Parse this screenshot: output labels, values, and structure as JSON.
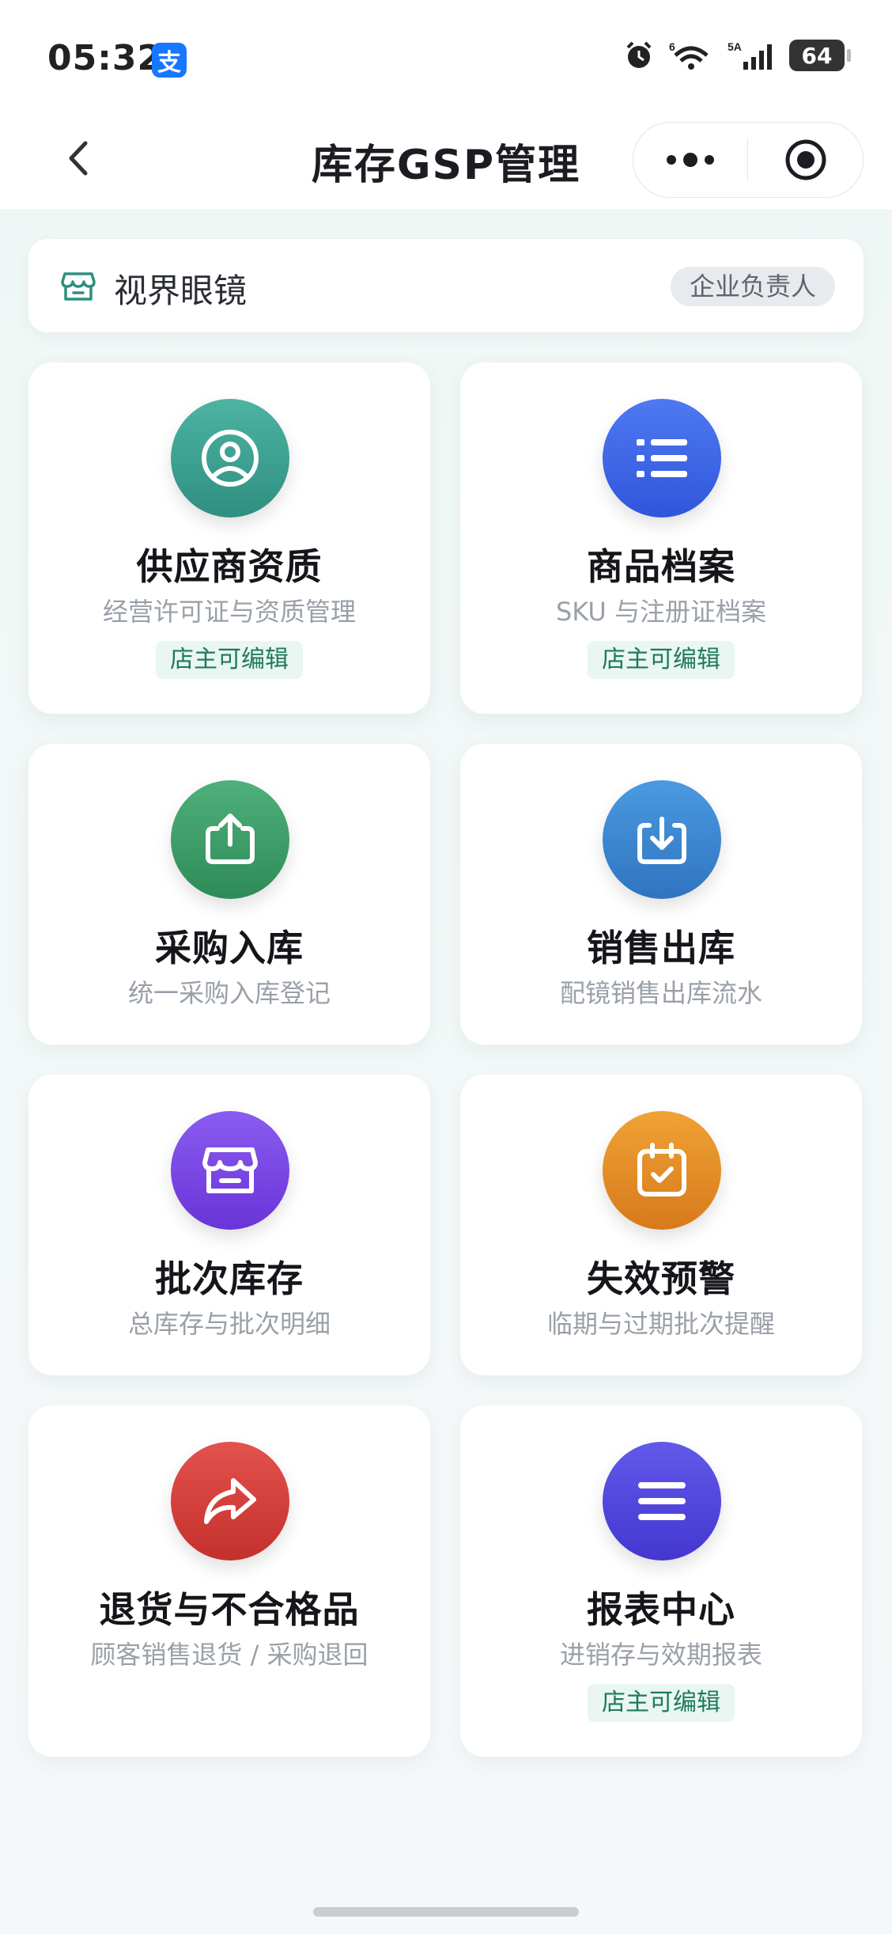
{
  "status_bar": {
    "time": "05:32",
    "app_badge": "支",
    "network": "6",
    "signal": "5A",
    "battery": "64"
  },
  "navbar": {
    "title": "库存GSP管理"
  },
  "org": {
    "name": "视界眼镜",
    "role": "企业负责人"
  },
  "cards": [
    {
      "title": "供应商资质",
      "subtitle": "经营许可证与资质管理",
      "tag": "店主可编辑",
      "icon": "user-circle-icon",
      "color": "#3f9f92"
    },
    {
      "title": "商品档案",
      "subtitle": "SKU 与注册证档案",
      "tag": "店主可编辑",
      "icon": "list-icon",
      "color": "#3d63e8"
    },
    {
      "title": "采购入库",
      "subtitle": "统一采购入库登记",
      "tag": "",
      "icon": "upload-box-icon",
      "color": "#3b9c66"
    },
    {
      "title": "销售出库",
      "subtitle": "配镜销售出库流水",
      "tag": "",
      "icon": "download-box-icon",
      "color": "#3a86cf"
    },
    {
      "title": "批次库存",
      "subtitle": "总库存与批次明细",
      "tag": "",
      "icon": "store-icon",
      "color": "#7b48e6"
    },
    {
      "title": "失效预警",
      "subtitle": "临期与过期批次提醒",
      "tag": "",
      "icon": "calendar-check-icon",
      "color": "#e08a24"
    },
    {
      "title": "退货与不合格品",
      "subtitle": "顾客销售退货 / 采购退回",
      "tag": "",
      "icon": "share-arrow-icon",
      "color": "#d83e3a"
    },
    {
      "title": "报表中心",
      "subtitle": "进销存与效期报表",
      "tag": "店主可编辑",
      "icon": "menu-lines-icon",
      "color": "#4e46dc"
    }
  ]
}
